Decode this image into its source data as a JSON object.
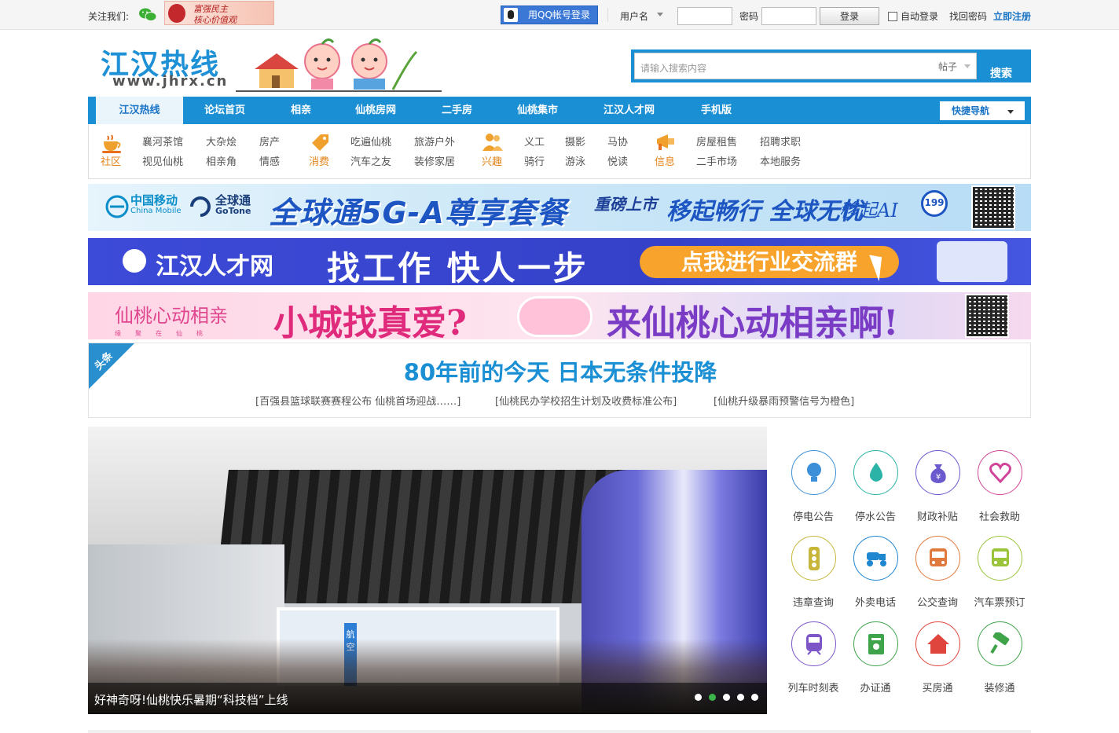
{
  "topbar": {
    "follow_label": "关注我们:",
    "core_values": [
      "富强民主",
      "核心价值观"
    ],
    "qq_login": "用QQ帐号登录",
    "username_label": "用户名",
    "password_label": "密码",
    "login_button": "登录",
    "auto_login": "自动登录",
    "find_password": "找回密码",
    "register": "立即注册"
  },
  "header": {
    "logo_text": "江汉热线",
    "logo_url": "www.jhrx.cn",
    "search_placeholder": "请输入搜索内容",
    "search_type": "帖子",
    "search_button": "搜索"
  },
  "nav": {
    "items": [
      "江汉热线",
      "论坛首页",
      "相亲",
      "仙桃房网",
      "二手房",
      "仙桃集市",
      "江汉人才网",
      "手机版"
    ],
    "quick_nav": "快捷导航"
  },
  "subnav": [
    {
      "category": "社区",
      "links": [
        "襄河茶馆",
        "大杂烩",
        "房产",
        "视见仙桃",
        "相亲角",
        "情感"
      ]
    },
    {
      "category": "消费",
      "links": [
        "吃遍仙桃",
        "旅游户外",
        "汽车之友",
        "装修家居"
      ]
    },
    {
      "category": "兴趣",
      "links": [
        "义工",
        "摄影",
        "马协",
        "骑行",
        "游泳",
        "悦读"
      ]
    },
    {
      "category": "信息",
      "links": [
        "房屋租售",
        "招聘求职",
        "二手市场",
        "本地服务"
      ]
    }
  ],
  "banners": {
    "b1": {
      "brand1": "中国移动",
      "brand1_en": "China Mobile",
      "brand2": "全球通",
      "brand2_en": "GoTone",
      "main": "全球通5G-A尊享套餐",
      "new": "重磅上市",
      "slogan": "移起畅行 全球无忧",
      "ai": "移起AI",
      "price": "199"
    },
    "b2": {
      "name": "江汉人才网",
      "slogan": "找工作 快人一步",
      "pill": "点我进行业交流群"
    },
    "b3": {
      "brand": "仙桃心动相亲",
      "brand_sub": "缘聚在仙桃",
      "q1": "小城找真爱?",
      "q2": "来仙桃心动相亲啊!"
    }
  },
  "headline": {
    "tag": "头条",
    "title": "80年前的今天 日本无条件投降",
    "subs": [
      "[百强县篮球联赛赛程公布 仙桃首场迎战……]",
      "[仙桃民办学校招生计划及收费标准公布]",
      "[仙桃升级暴雨预警信号为橙色]"
    ]
  },
  "slider": {
    "caption": "好神奇呀!仙桃快乐暑期“科技档”上线",
    "board_text": "航空",
    "dots": 5,
    "active_dot": 1
  },
  "services": [
    {
      "label": "停电公告",
      "icon": "bulb-icon",
      "color": "#3b8fd8"
    },
    {
      "label": "停水公告",
      "icon": "water-drop-icon",
      "color": "#2ab3a6"
    },
    {
      "label": "财政补贴",
      "icon": "money-bag-icon",
      "color": "#6a5acd"
    },
    {
      "label": "社会救助",
      "icon": "heart-icon",
      "color": "#d0459a"
    },
    {
      "label": "违章查询",
      "icon": "traffic-light-icon",
      "color": "#c7b63a"
    },
    {
      "label": "外卖电话",
      "icon": "scooter-icon",
      "color": "#1f86d0"
    },
    {
      "label": "公交查询",
      "icon": "bus-icon",
      "color": "#e07a3c"
    },
    {
      "label": "汽车票预订",
      "icon": "coach-icon",
      "color": "#9ac43a"
    },
    {
      "label": "列车时刻表",
      "icon": "train-icon",
      "color": "#7d55c7"
    },
    {
      "label": "办证通",
      "icon": "certificate-icon",
      "color": "#3fa34a"
    },
    {
      "label": "买房通",
      "icon": "house-icon",
      "color": "#e0453d"
    },
    {
      "label": "装修通",
      "icon": "paint-roller-icon",
      "color": "#3fa34a"
    }
  ]
}
